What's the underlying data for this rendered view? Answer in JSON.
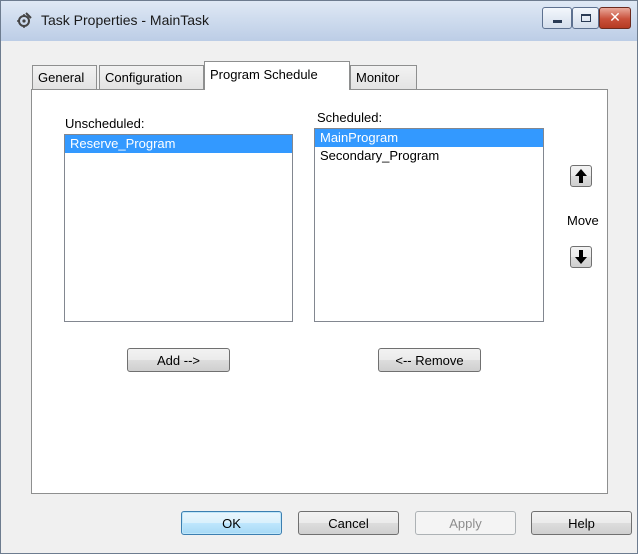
{
  "window": {
    "title": "Task Properties - MainTask",
    "close_glyph": "✕"
  },
  "tabs": [
    {
      "label": "General",
      "active": false
    },
    {
      "label": "Configuration",
      "active": false
    },
    {
      "label": "Program Schedule",
      "active": true
    },
    {
      "label": "Monitor",
      "active": false
    }
  ],
  "unscheduled": {
    "label": "Unscheduled:",
    "items": [
      "Reserve_Program"
    ],
    "selected": "Reserve_Program"
  },
  "scheduled": {
    "label": "Scheduled:",
    "items": [
      "MainProgram",
      "Secondary_Program"
    ],
    "selected": "MainProgram"
  },
  "buttons": {
    "add": "Add -->",
    "remove": "<-- Remove",
    "move_label": "Move",
    "ok": "OK",
    "cancel": "Cancel",
    "apply": "Apply",
    "help": "Help"
  },
  "icons": {
    "app": "task-gear-icon",
    "move_up": "arrow-up-icon",
    "move_down": "arrow-down-icon"
  }
}
